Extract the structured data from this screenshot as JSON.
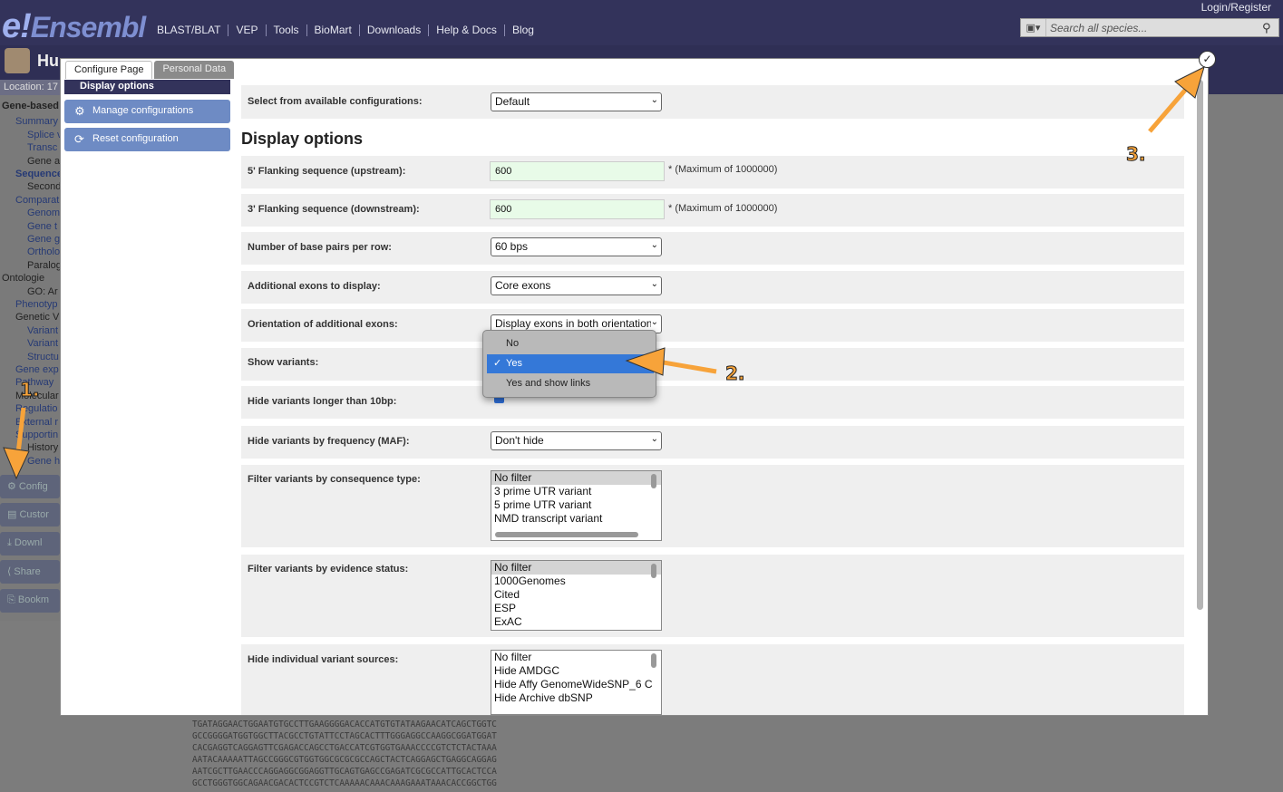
{
  "header": {
    "logo": "Ensembl",
    "logo_e": "e!",
    "nav": [
      "BLAST/BLAT",
      "VEP",
      "Tools",
      "BioMart",
      "Downloads",
      "Help & Docs",
      "Blog"
    ],
    "login": "Login/Register",
    "search_placeholder": "Search all species..."
  },
  "species_title": "Hu",
  "location_label": "Location: 17",
  "sidebar": {
    "items": [
      "Gene-based",
      "Summary",
      "Splice v",
      "Transc",
      "Gene a",
      "Sequence",
      "Second",
      "Comparat",
      "Genom",
      "Gene t",
      "Gene g",
      "Ortholo",
      "Paralog",
      "Ontologie",
      "GO: Ar",
      "Phenotyp",
      "Genetic V",
      "Variant",
      "Variant",
      "Structu",
      "Gene exp",
      "Pathway",
      "Molecular",
      "Regulatio",
      "External r",
      "Supportin",
      "History",
      "Gene h"
    ],
    "buttons": [
      "Config",
      "Custor",
      "Downl",
      "Share",
      "Bookm"
    ]
  },
  "modal": {
    "tabs": [
      "Configure Page",
      "Personal Data"
    ],
    "close_icon": "check-close",
    "left_nav": {
      "heading": "Display options",
      "buttons": [
        "Manage configurations",
        "Reset configuration"
      ]
    },
    "config_label": "Select from available configurations:",
    "config_value": "Default",
    "section_title": "Display options",
    "flank5_label": "5' Flanking sequence (upstream):",
    "flank5_value": "600",
    "flank3_label": "3' Flanking sequence (downstream):",
    "flank3_value": "600",
    "max_note": "* (Maximum of 1000000)",
    "bp_label": "Number of base pairs per row:",
    "bp_value": "60 bps",
    "exons_label": "Additional exons to display:",
    "exons_value": "Core exons",
    "orient_label": "Orientation of additional exons:",
    "orient_value": "Display exons in both orientations",
    "variants_label": "Show variants:",
    "variants_options": [
      "No",
      "Yes",
      "Yes and show links"
    ],
    "variants_selected": "Yes",
    "hide10_label": "Hide variants longer than 10bp:",
    "maf_label": "Hide variants by frequency (MAF):",
    "maf_value": "Don't hide",
    "conseq_label": "Filter variants by consequence type:",
    "conseq_options": [
      "No filter",
      "3 prime UTR variant",
      "5 prime UTR variant",
      "NMD transcript variant"
    ],
    "evidence_label": "Filter variants by evidence status:",
    "evidence_options": [
      "No filter",
      "1000Genomes",
      "Cited",
      "ESP",
      "ExAC"
    ],
    "sources_label": "Hide individual variant sources:",
    "sources_options": [
      "No filter",
      "Hide AMDGC",
      "Hide Affy GenomeWideSNP_6 C",
      "Hide Archive dbSNP"
    ]
  },
  "annotations": [
    "1.",
    "2.",
    "3."
  ],
  "sequence_lines": [
    "TGATAGGAACTGGAATGTGCCTTGAAGGGGACACCATGTGTATAAGAACATCAGCTGGTC",
    "GCCGGGGATGGTGGCTTACGCCTGTATTCCTAGCACTTTGGGAGGCCAAGGCGGATGGAT",
    "CACGAGGTCAGGAGTTCGAGACCAGCCTGACCATCGTGGTGAAACCCCGTCTCTACTAAA",
    "AATACAAAAATTAGCCGGGCGTGGTGGCGCGCGCCAGCTACTCAGGAGCTGAGGCAGGAG",
    "AATCGCTTGAACCCAGGAGGCGGAGGTTGCAGTGAGCCGAGATCGCGCCATTGCACTCCA",
    "GCCTGGGTGGCAGAACGACACTCCGTCTCAAAAACAAACAAAGAAATAAACACCGGCTGG"
  ]
}
